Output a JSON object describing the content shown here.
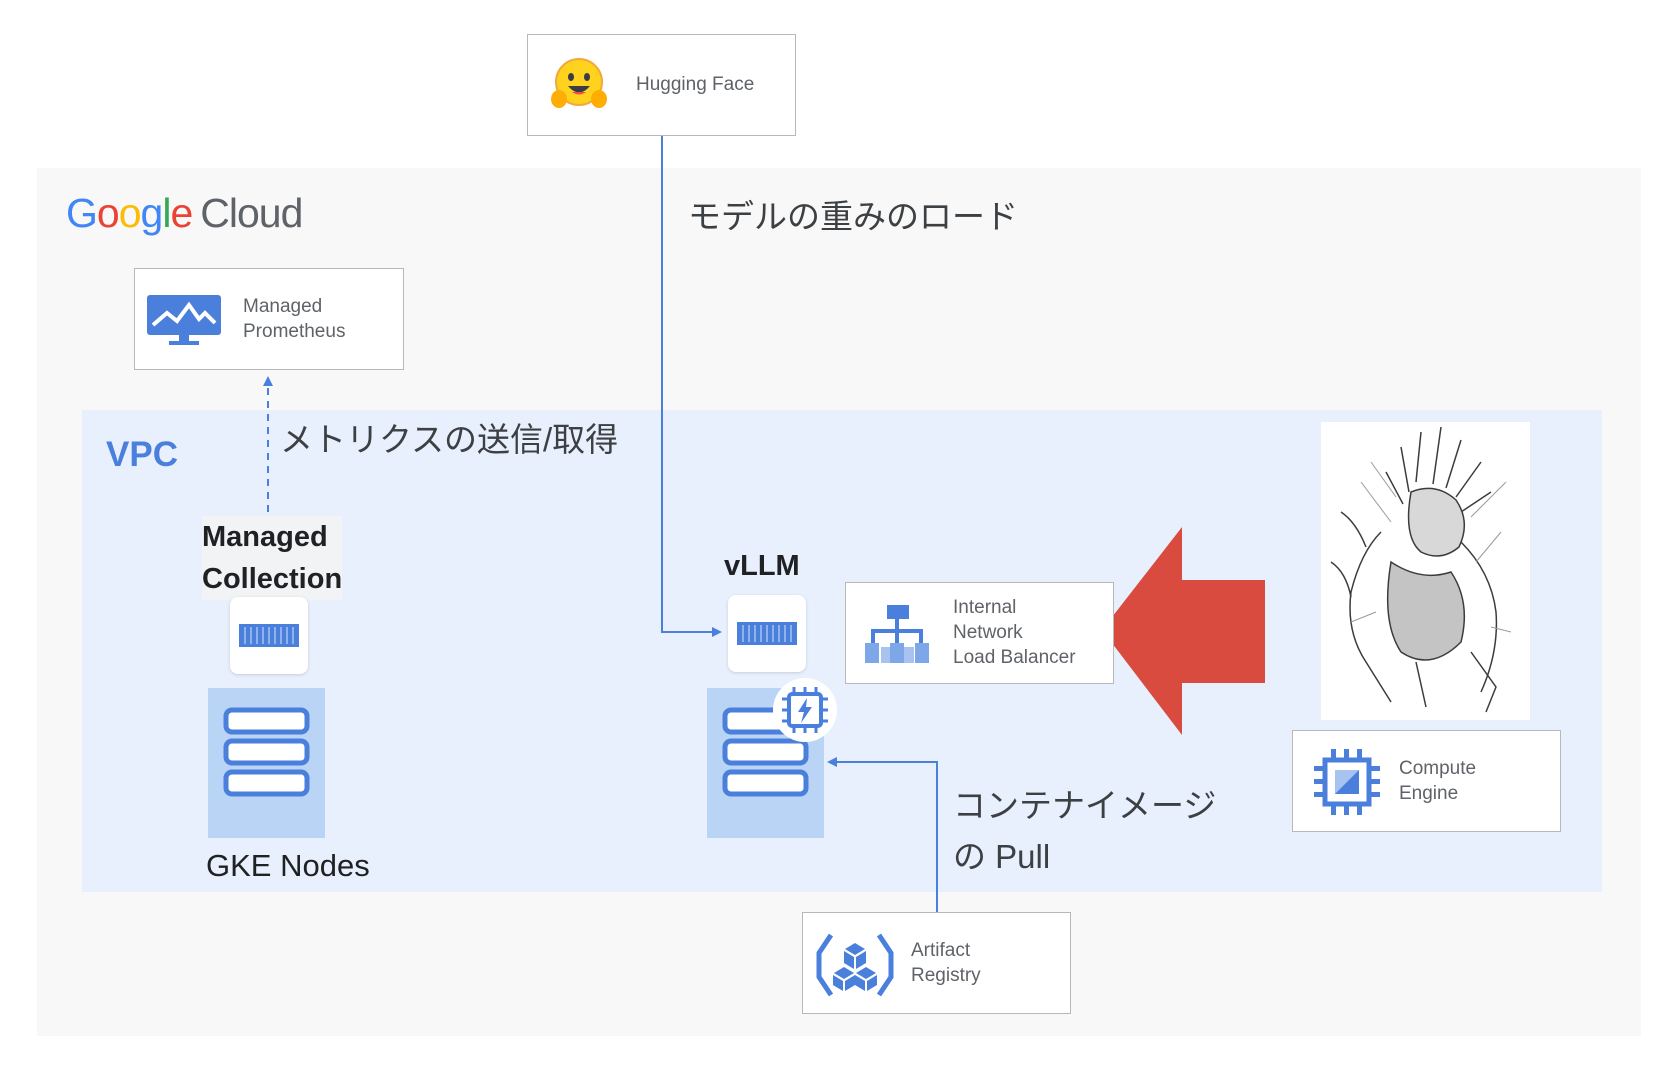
{
  "cloud": {
    "brand_google": "Google",
    "brand_cloud": "Cloud",
    "letter_colors": [
      "#4285F4",
      "#EA4335",
      "#FBBC05",
      "#4285F4",
      "#34A853",
      "#EA4335"
    ]
  },
  "vpc": {
    "label": "VPC"
  },
  "nodes": {
    "huggingface": {
      "label": "Hugging Face",
      "icon": "hugging-face-emoji-icon"
    },
    "prometheus": {
      "label": "Managed\nPrometheus",
      "icon": "monitoring-icon"
    },
    "load_balancer": {
      "label": "Internal\nNetwork\nLoad Balancer",
      "icon": "load-balancer-icon"
    },
    "compute_engine": {
      "label": "Compute\nEngine",
      "icon": "compute-engine-icon"
    },
    "artifact_registry": {
      "label": "Artifact\nRegistry",
      "icon": "artifact-registry-icon"
    },
    "managed_collection": {
      "label": "Managed\nCollection"
    },
    "vllm": {
      "label": "vLLM"
    },
    "gke_nodes": {
      "label": "GKE Nodes"
    }
  },
  "edges": {
    "weights": {
      "label": "モデルの重みのロード"
    },
    "metrics": {
      "label": "メトリクスの送信/取得"
    },
    "image_pull": {
      "label": "コンテナイメージ\nの Pull"
    }
  },
  "colors": {
    "accent": "#4a7fdc",
    "arrow_red": "#d94b3e",
    "node_fill": "#b9d4f5",
    "vpc_bg": "#e8f0fe"
  }
}
